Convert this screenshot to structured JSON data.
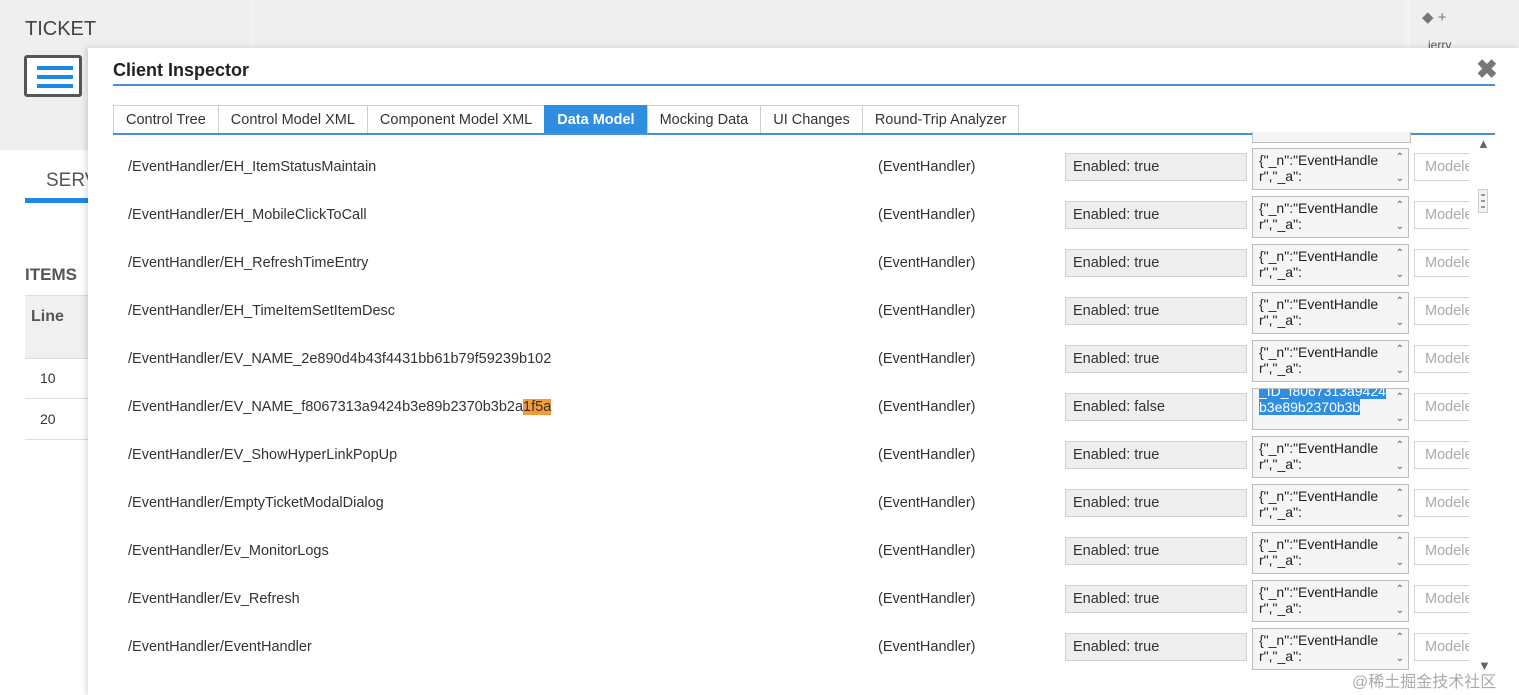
{
  "background": {
    "ticket_title": "TICKET",
    "serv_tab": "SERV",
    "items_title": "ITEMS",
    "line_header": "Line",
    "lines": [
      "10",
      "20"
    ],
    "user": "jerry",
    "tag_icon": "tag-plus-icon"
  },
  "dialog": {
    "title": "Client Inspector",
    "close_icon": "close-icon",
    "tabs": [
      {
        "label": "Control Tree"
      },
      {
        "label": "Control Model XML"
      },
      {
        "label": "Component Model XML"
      },
      {
        "label": "Data Model",
        "active": true
      },
      {
        "label": "Mocking Data"
      },
      {
        "label": "UI Changes"
      },
      {
        "label": "Round-Trip Analyzer"
      }
    ],
    "rows": [
      {
        "path": "/EventHandler/EH_ItemStatusMaintain",
        "type": "(EventHandler)",
        "enabled": "Enabled: true",
        "json": "{\"_n\":\"EventHandler\",\"_a\":",
        "button": "Modeled"
      },
      {
        "path": "/EventHandler/EH_MobileClickToCall",
        "type": "(EventHandler)",
        "enabled": "Enabled: true",
        "json": "{\"_n\":\"EventHandler\",\"_a\":",
        "button": "Modeled"
      },
      {
        "path": "/EventHandler/EH_RefreshTimeEntry",
        "type": "(EventHandler)",
        "enabled": "Enabled: true",
        "json": "{\"_n\":\"EventHandler\",\"_a\":",
        "button": "Modeled"
      },
      {
        "path": "/EventHandler/EH_TimeItemSetItemDesc",
        "type": "(EventHandler)",
        "enabled": "Enabled: true",
        "json": "{\"_n\":\"EventHandler\",\"_a\":",
        "button": "Modeled"
      },
      {
        "path": "/EventHandler/EV_NAME_2e890d4b43f4431bb61b79f59239b102",
        "type": "(EventHandler)",
        "enabled": "Enabled: true",
        "json": "{\"_n\":\"EventHandler\",\"_a\":",
        "button": "Modeled"
      },
      {
        "path": "/EventHandler/EV_NAME_f8067313a9424b3e89b2370b3b2a",
        "path_highlight": "1f5a",
        "type": "(EventHandler)",
        "enabled": "Enabled: false",
        "json": "_ID_f8067313a9424b3e89b2370b3b",
        "json_selected": true,
        "button": "Modeled"
      },
      {
        "path": "/EventHandler/EV_ShowHyperLinkPopUp",
        "type": "(EventHandler)",
        "enabled": "Enabled: true",
        "json": "{\"_n\":\"EventHandler\",\"_a\":",
        "button": "Modeled"
      },
      {
        "path": "/EventHandler/EmptyTicketModalDialog",
        "type": "(EventHandler)",
        "enabled": "Enabled: true",
        "json": "{\"_n\":\"EventHandler\",\"_a\":",
        "button": "Modeled"
      },
      {
        "path": "/EventHandler/Ev_MonitorLogs",
        "type": "(EventHandler)",
        "enabled": "Enabled: true",
        "json": "{\"_n\":\"EventHandler\",\"_a\":",
        "button": "Modeled"
      },
      {
        "path": "/EventHandler/Ev_Refresh",
        "type": "(EventHandler)",
        "enabled": "Enabled: true",
        "json": "{\"_n\":\"EventHandler\",\"_a\":",
        "button": "Modeled"
      },
      {
        "path": "/EventHandler/EventHandler",
        "type": "(EventHandler)",
        "enabled": "Enabled: true",
        "json": "{\"_n\":\"EventHandler\",\"_a\":",
        "button": "Modeled"
      }
    ]
  },
  "watermark": "@稀土掘金技术社区",
  "colors": {
    "accent": "#2f8ee0",
    "highlight": "#f39a3a"
  }
}
